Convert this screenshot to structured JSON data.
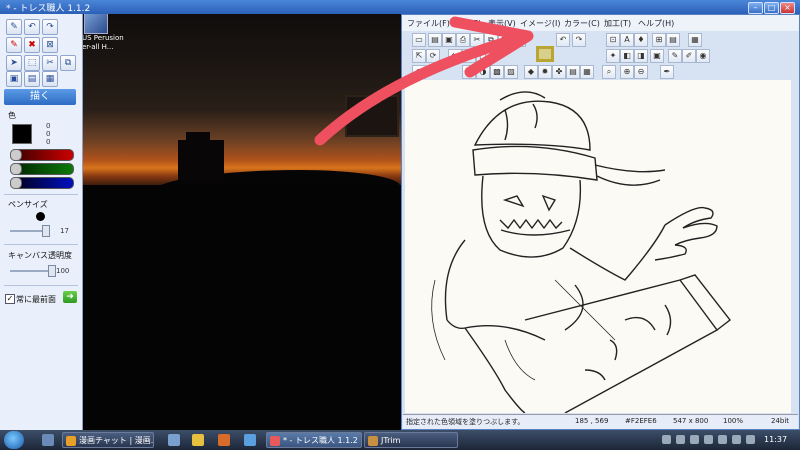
{
  "desktop": {
    "icon_label_line1": "US Perusion",
    "icon_label_line2": "er-all H..."
  },
  "left_app": {
    "title": "* - トレス職人 1.1.2",
    "draw_button": "描く",
    "color_label": "色",
    "color_values": [
      "0",
      "0",
      "0"
    ],
    "pen_size_label": "ペンサイズ",
    "pen_size_value": "17",
    "canvas_opacity_label": "キャンバス透明度",
    "canvas_opacity_value": "100",
    "always_on_top_label": "常に最前面",
    "always_on_top_checked": "✓",
    "channel_colors": [
      "#cc0000",
      "#0a7a0a",
      "#0010c0"
    ]
  },
  "right_app": {
    "menus": [
      "ファイル(F)",
      "編集(E)",
      "表示(V)",
      "イメージ(I)",
      "カラー(C)",
      "加工(T)",
      "ヘルプ(H)"
    ],
    "status": {
      "message": "指定された色領域を塗りつぶします。",
      "coords": "185 , 569",
      "color_code": "#F2EFE6",
      "size": "547 x 800",
      "zoom": "100%",
      "depth": "24bit"
    }
  },
  "annotation": {
    "arrow_color": "#ef5060",
    "highlight_color": "#b8a532"
  },
  "taskbar": {
    "tasks": [
      "漫画チャット | 漫画...",
      "* - トレス職人 1.1.2",
      "JTrim"
    ],
    "clock": "11:37"
  }
}
